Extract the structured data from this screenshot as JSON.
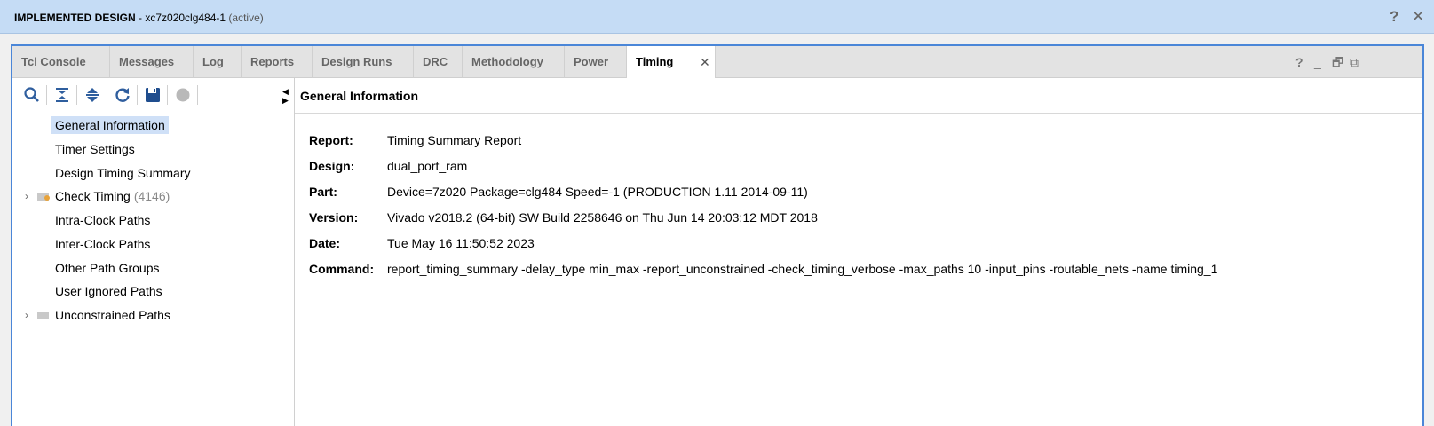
{
  "window": {
    "title_bold": "IMPLEMENTED DESIGN",
    "title_rest": " - xc7z020clg484-1",
    "title_status": "(active)",
    "help": "?",
    "close": "✕"
  },
  "tabs": [
    {
      "label": "Tcl Console"
    },
    {
      "label": "Messages"
    },
    {
      "label": "Log"
    },
    {
      "label": "Reports"
    },
    {
      "label": "Design Runs"
    },
    {
      "label": "DRC"
    },
    {
      "label": "Methodology"
    },
    {
      "label": "Power"
    },
    {
      "label": "Timing",
      "active": true,
      "close": "✕"
    }
  ],
  "window_controls": {
    "help": "?",
    "minimize": "_",
    "restore": "🗗",
    "float": "⧉"
  },
  "toolbar": {
    "icons": [
      "search-icon",
      "collapse-all-icon",
      "expand-all-icon",
      "refresh-icon",
      "save-icon",
      "stop-icon"
    ],
    "collapse_arrows": "◀▶"
  },
  "tree": [
    {
      "label": "General Information",
      "selected": true
    },
    {
      "label": "Timer Settings"
    },
    {
      "label": "Design Timing Summary"
    },
    {
      "label": "Check Timing",
      "count": "(4146)",
      "expander": "›",
      "folder": "warning"
    },
    {
      "label": "Intra-Clock Paths"
    },
    {
      "label": "Inter-Clock Paths"
    },
    {
      "label": "Other Path Groups"
    },
    {
      "label": "User Ignored Paths"
    },
    {
      "label": "Unconstrained Paths",
      "expander": "›",
      "folder": "plain"
    }
  ],
  "panel": {
    "title": "General Information",
    "rows": [
      {
        "key": "Report:",
        "value": "Timing Summary Report"
      },
      {
        "key": "Design:",
        "value": "dual_port_ram"
      },
      {
        "key": "Part:",
        "value": "Device=7z020 Package=clg484 Speed=-1 (PRODUCTION 1.11 2014-09-11)"
      },
      {
        "key": "Version:",
        "value": "Vivado v2018.2 (64-bit) SW Build 2258646 on Thu Jun 14 20:03:12 MDT 2018"
      },
      {
        "key": "Date:",
        "value": "Tue May 16 11:50:52 2023"
      },
      {
        "key": "Command:",
        "value": "report_timing_summary -delay_type min_max -report_unconstrained -check_timing_verbose -max_paths 10 -input_pins -routable_nets -name timing_1"
      }
    ]
  },
  "colors": {
    "accent": "#4a86d8",
    "titlebar": "#c5dcf5",
    "selection": "#cfe0f7",
    "toolbar_icon": "#2f5e9e",
    "folder_warning": "#e8a33a"
  }
}
